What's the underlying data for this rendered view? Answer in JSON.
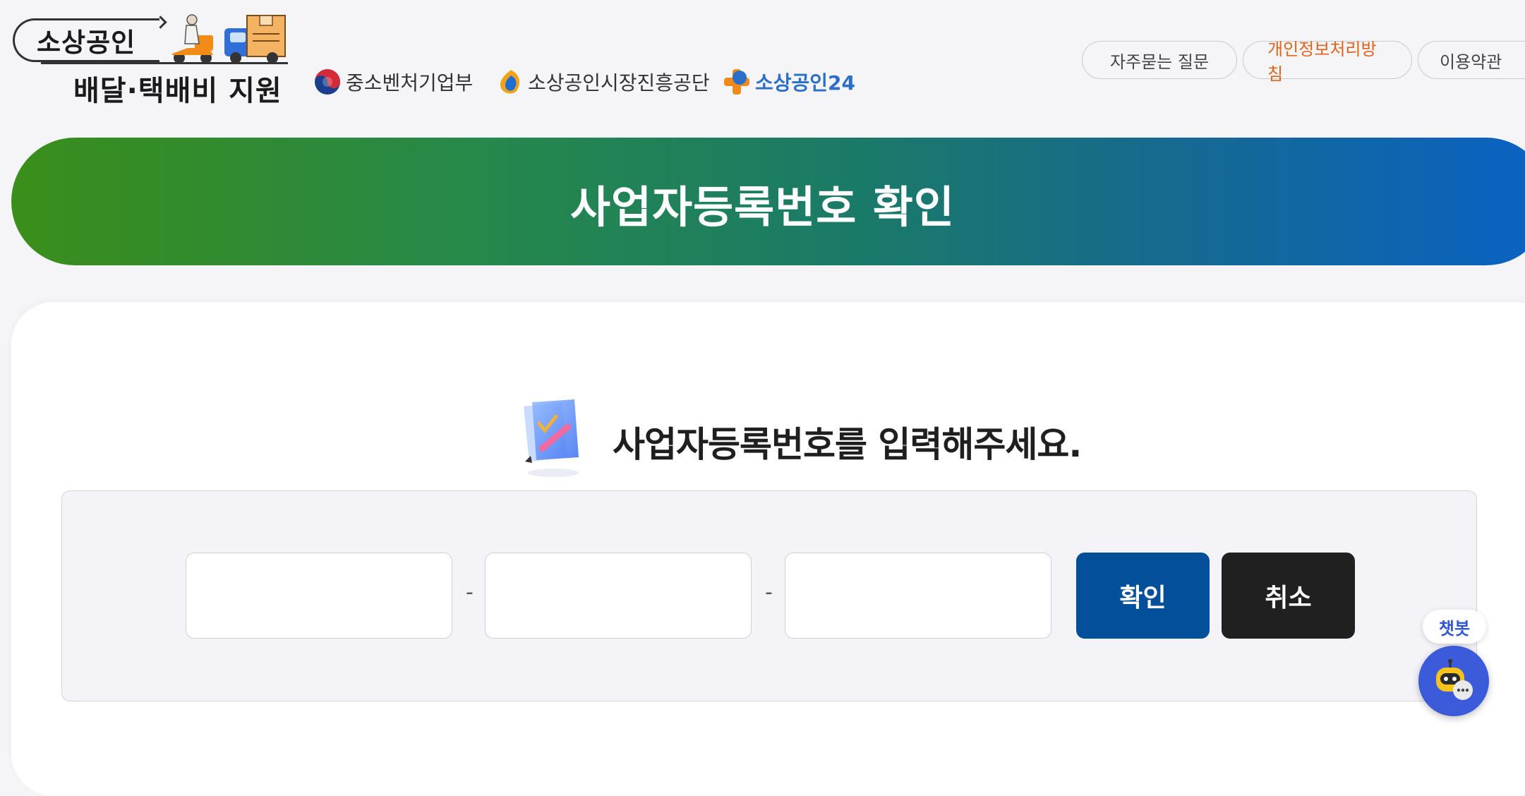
{
  "header": {
    "logo_top": "소상공인",
    "logo_bottom": "배달·택배비 지원",
    "agencies": {
      "mss": "중소벤처기업부",
      "semas": "소상공인시장진흥공단",
      "sb24": "소상공인24"
    },
    "links": {
      "faq": "자주묻는 질문",
      "privacy": "개인정보처리방침",
      "terms": "이용약관"
    }
  },
  "banner": {
    "title": "사업자등록번호 확인"
  },
  "form": {
    "heading": "사업자등록번호를 입력해주세요.",
    "input1": {
      "value": "",
      "placeholder": ""
    },
    "input2": {
      "value": "",
      "placeholder": ""
    },
    "input3": {
      "value": "",
      "placeholder": ""
    },
    "separator": "-",
    "confirm_label": "확인",
    "cancel_label": "취소"
  },
  "chatbot": {
    "label": "챗봇"
  },
  "colors": {
    "banner_start": "#3a8e1a",
    "banner_end": "#0a62c4",
    "confirm_button": "#044f9a",
    "cancel_button": "#202020",
    "privacy_link": "#e0651c"
  }
}
